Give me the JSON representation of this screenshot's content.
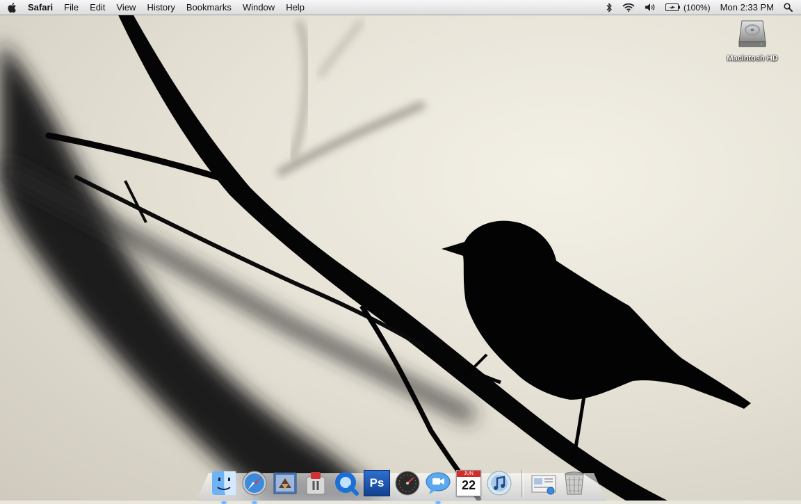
{
  "menubar": {
    "apple_icon": "apple-icon",
    "app_name": "Safari",
    "menus": [
      "File",
      "Edit",
      "View",
      "History",
      "Bookmarks",
      "Window",
      "Help"
    ],
    "status": {
      "bluetooth_icon": "bluetooth-icon",
      "wifi_icon": "wifi-icon",
      "volume_icon": "volume-icon",
      "battery_icon": "battery-icon",
      "battery_percent": "(100%)",
      "clock": "Mon 2:33 PM",
      "spotlight_icon": "spotlight-icon"
    }
  },
  "desktop": {
    "icons": [
      {
        "label": "Macintosh HD",
        "icon": "hard-drive-icon"
      }
    ]
  },
  "dock": {
    "apps": [
      {
        "name": "Finder",
        "icon": "finder-icon",
        "running": true
      },
      {
        "name": "Safari",
        "icon": "safari-icon",
        "running": true
      },
      {
        "name": "Mail",
        "icon": "mail-icon",
        "running": false
      },
      {
        "name": "Transmit",
        "icon": "transmit-icon",
        "running": false
      },
      {
        "name": "QuickTime",
        "icon": "quicktime-icon",
        "running": false
      },
      {
        "name": "Photoshop",
        "icon": "photoshop-icon",
        "label": "Ps",
        "running": false
      },
      {
        "name": "Dashboard",
        "icon": "dashboard-icon",
        "running": false
      },
      {
        "name": "iChat",
        "icon": "ichat-icon",
        "running": true
      },
      {
        "name": "iCal",
        "icon": "ical-icon",
        "month": "JUN",
        "day": "22",
        "running": false
      },
      {
        "name": "iTunes",
        "icon": "itunes-icon",
        "running": false
      }
    ],
    "others": [
      {
        "name": "Preview",
        "icon": "preview-icon"
      },
      {
        "name": "Trash",
        "icon": "trash-icon"
      }
    ]
  }
}
